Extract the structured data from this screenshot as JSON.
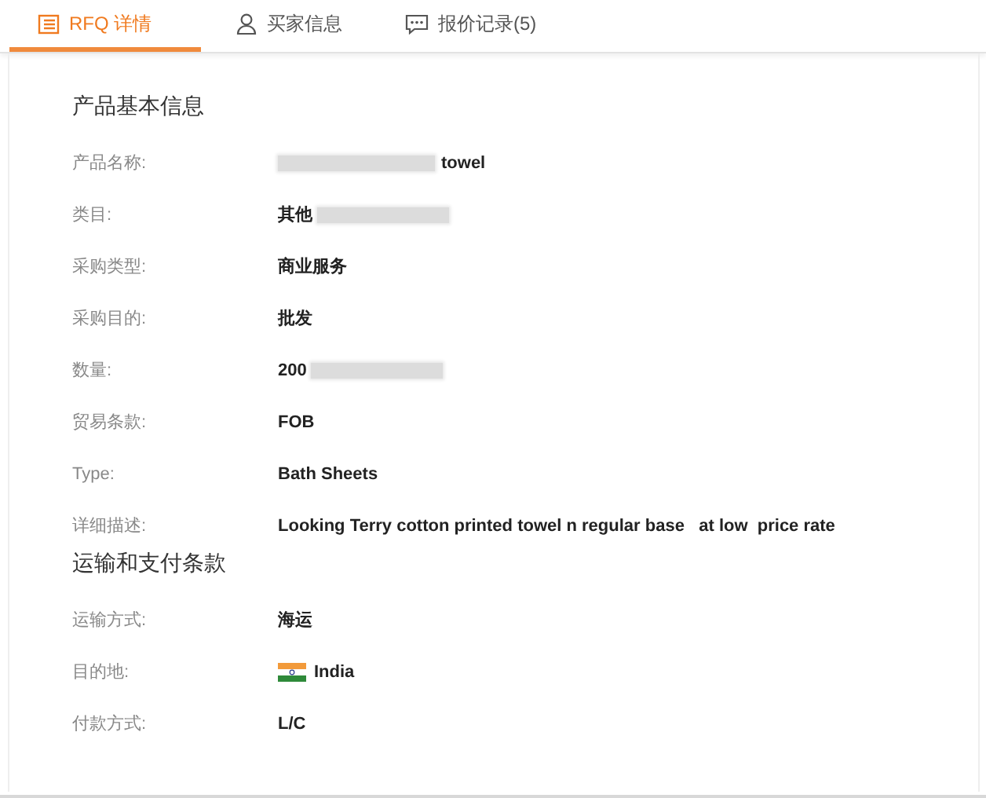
{
  "tabs": [
    {
      "label": "RFQ 详情",
      "selected": true
    },
    {
      "label": "买家信息",
      "selected": false
    },
    {
      "label": "报价记录(5)",
      "selected": false
    }
  ],
  "sections": [
    {
      "title": "产品基本信息",
      "rows": [
        {
          "label": "产品名称:",
          "value": "towel",
          "kind": "text",
          "blurred_before": true,
          "blurred_after": false
        },
        {
          "label": "类目:",
          "value": "其他",
          "kind": "text",
          "blurred_before": false,
          "blurred_after": true
        },
        {
          "label": "采购类型:",
          "value": "商业服务",
          "kind": "text",
          "blurred_before": false,
          "blurred_after": false
        },
        {
          "label": "采购目的:",
          "value": "批发",
          "kind": "text",
          "blurred_before": false,
          "blurred_after": false
        },
        {
          "label": "数量:",
          "value": "200",
          "kind": "text",
          "blurred_before": false,
          "blurred_after": true
        },
        {
          "label": "贸易条款:",
          "value": "FOB",
          "kind": "text",
          "blurred_before": false,
          "blurred_after": false
        },
        {
          "label": "Type:",
          "value": "Bath Sheets",
          "kind": "text",
          "blurred_before": false,
          "blurred_after": false
        },
        {
          "label": "详细描述:",
          "value": "Looking Terry cotton printed towel n regular base   at low  price rate",
          "kind": "text",
          "blurred_before": false,
          "blurred_after": false
        }
      ]
    },
    {
      "title": "运输和支付条款",
      "rows": [
        {
          "label": "运输方式:",
          "value": "海运",
          "kind": "text",
          "blurred_before": false,
          "blurred_after": false
        },
        {
          "label": "目的地:",
          "value": "India",
          "kind": "country",
          "blurred_before": false,
          "blurred_after": false
        },
        {
          "label": "付款方式:",
          "value": "L/C",
          "kind": "text",
          "blurred_before": false,
          "blurred_after": false
        }
      ]
    }
  ]
}
